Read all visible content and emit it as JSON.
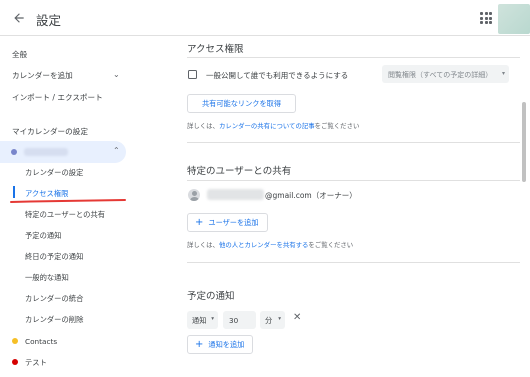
{
  "header": {
    "title": "設定"
  },
  "sidebar": {
    "items": [
      {
        "label": "全般"
      },
      {
        "label": "カレンダーを追加"
      },
      {
        "label": "インポート / エクスポート"
      }
    ],
    "my_calendars_heading": "マイカレンダーの設定",
    "selected_calendar": {
      "color": "#7986cb"
    },
    "sub_items": [
      {
        "label": "カレンダーの設定"
      },
      {
        "label": "アクセス権限"
      },
      {
        "label": "特定のユーザーとの共有"
      },
      {
        "label": "予定の通知"
      },
      {
        "label": "終日の予定の通知"
      },
      {
        "label": "一般的な通知"
      },
      {
        "label": "カレンダーの統合"
      },
      {
        "label": "カレンダーの削除"
      }
    ],
    "other_calendars": [
      {
        "label": "Contacts",
        "color": "#f6bf26"
      },
      {
        "label": "テスト",
        "color": "#d50000"
      }
    ]
  },
  "access": {
    "title": "アクセス権限",
    "public_label": "一般公開して誰でも利用できるようにする",
    "permission_select": "閲覧権限（すべての予定の詳細）",
    "share_link_button": "共有可能なリンクを取得",
    "help_prefix": "詳しくは、",
    "help_link": "カレンダーの共有についての記事",
    "help_suffix": "をご覧ください"
  },
  "sharing": {
    "title": "特定のユーザーとの共有",
    "user_email": "@gmail.com（オーナー）",
    "add_user_button": "ユーザーを追加",
    "help_prefix": "詳しくは、",
    "help_link": "他の人とカレンダーを共有する",
    "help_suffix": "をご覧ください"
  },
  "notifications": {
    "title": "予定の通知",
    "type_select": "通知",
    "amount": "30",
    "unit_select": "分",
    "add_button": "通知を追加"
  }
}
